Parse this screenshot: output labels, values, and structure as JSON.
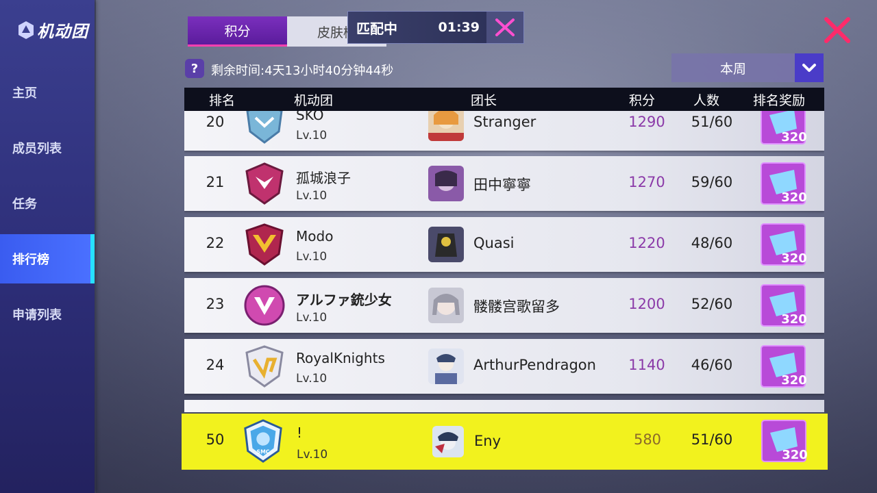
{
  "sidebar": {
    "title": "机动团",
    "items": [
      {
        "label": "主页",
        "active": false
      },
      {
        "label": "成员列表",
        "active": false
      },
      {
        "label": "任务",
        "active": false
      },
      {
        "label": "排行榜",
        "active": true
      },
      {
        "label": "申请列表",
        "active": false
      }
    ]
  },
  "tabs": [
    {
      "label": "积分",
      "active": true
    },
    {
      "label": "皮肤榜",
      "active": false
    }
  ],
  "matching": {
    "label": "匹配中",
    "timer": "01:39"
  },
  "remaining_time": "剩余时间:4天13小时40分钟44秒",
  "period_dropdown": {
    "selected": "本周"
  },
  "table": {
    "headers": {
      "rank": "排名",
      "group": "机动团",
      "leader": "团长",
      "score": "积分",
      "members": "人数",
      "reward": "排名奖励"
    },
    "rows": [
      {
        "rank": "20",
        "group": "SKO",
        "level": "Lv.10",
        "leader": "Stranger",
        "score": "1290",
        "members": "51/60",
        "reward": "320"
      },
      {
        "rank": "21",
        "group": "孤城浪子",
        "level": "Lv.10",
        "leader": "田中寧寧",
        "score": "1270",
        "members": "59/60",
        "reward": "320"
      },
      {
        "rank": "22",
        "group": "Modo",
        "level": "Lv.10",
        "leader": "Quasi",
        "score": "1220",
        "members": "48/60",
        "reward": "320"
      },
      {
        "rank": "23",
        "group": "アルファ銃少女",
        "level": "Lv.10",
        "leader": "髅髅宫歌留多",
        "score": "1200",
        "members": "52/60",
        "reward": "320"
      },
      {
        "rank": "24",
        "group": "RoyalKnights",
        "level": "Lv.10",
        "leader": "ArthurPendragon",
        "score": "1140",
        "members": "46/60",
        "reward": "320"
      }
    ],
    "my_row": {
      "rank": "50",
      "group": "!",
      "level": "Lv.10",
      "leader": "Eny",
      "score": "580",
      "members": "51/60",
      "reward": "320",
      "emblem_text": "SMC"
    }
  },
  "colors": {
    "highlight": "#f2f21e",
    "accent": "#7a2fbd",
    "score": "#8b3aa8",
    "close": "#ff2a6a"
  }
}
